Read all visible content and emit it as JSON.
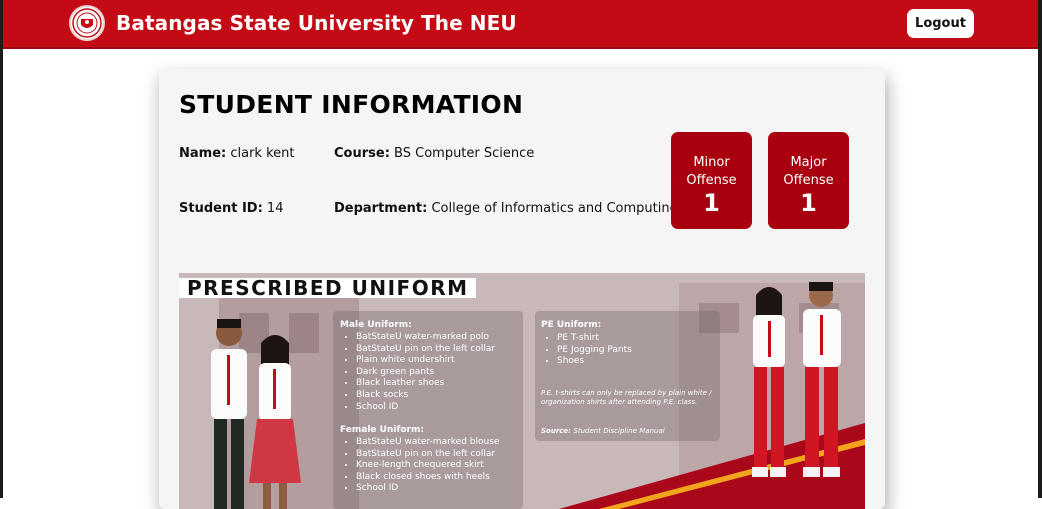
{
  "app": {
    "brand": "Batangas State University The NEU"
  },
  "header": {
    "logout_label": "Logout"
  },
  "student": {
    "heading": "STUDENT INFORMATION",
    "name_label": "Name:",
    "name": "clark kent",
    "course_label": "Course:",
    "course": "BS Computer Science",
    "id_label": "Student ID:",
    "id": "14",
    "department_label": "Department:",
    "department": "College of Informatics and Computing Sciences"
  },
  "offenses": {
    "minor_label_1": "Minor",
    "minor_label_2": "Offense",
    "minor_count": "1",
    "major_label_1": "Major",
    "major_label_2": "Offense",
    "major_count": "1"
  },
  "uniform": {
    "title": "PRESCRIBED UNIFORM",
    "male_heading": "Male Uniform:",
    "male_items": [
      "BatStateU water-marked polo",
      "BatStateU pin on the left collar",
      "Plain white undershirt",
      "Dark green pants",
      "Black leather shoes",
      "Black socks",
      "School ID"
    ],
    "female_heading": "Female Uniform:",
    "female_items": [
      "BatStateU water-marked blouse",
      "BatStateU pin on the left collar",
      "Knee-length chequered skirt",
      "Black closed shoes with heels",
      "School ID"
    ],
    "pe_heading": "PE Uniform:",
    "pe_items": [
      "PE T-shirt",
      "PE Jogging Pants",
      "Shoes"
    ],
    "pe_note": "P.E. t-shirts can only be replaced by plain white / organization shirts after attending P.E. class.",
    "source_label": "Source:",
    "source": "Student Discipline Manual"
  },
  "colors": {
    "brand_red": "#c40a14",
    "offense_red": "#a90010"
  }
}
